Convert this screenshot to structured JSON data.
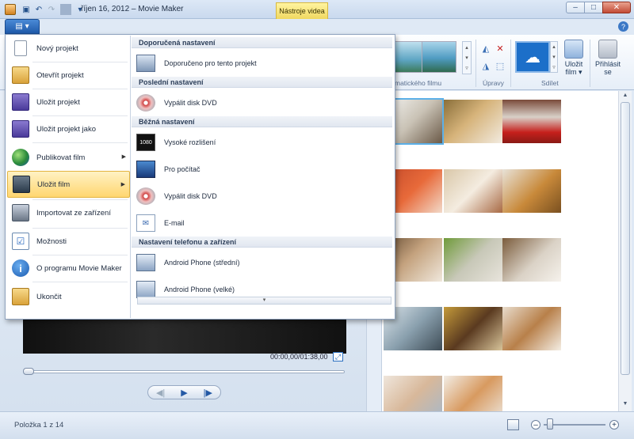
{
  "window": {
    "title": "říjen 16, 2012 – Movie Maker",
    "context_tab": "Nástroje videa",
    "controls": {
      "minimize": "–",
      "maximize": "□",
      "close": "✕"
    }
  },
  "quick_access": [
    "save-icon",
    "undo-icon",
    "redo-icon",
    "dropdown-icon"
  ],
  "ribbon": {
    "file_button_label": "▤ ▾",
    "help": "?",
    "groups": {
      "themes_label": "matického filmu",
      "edit_label": "Úpravy",
      "share_label": "Sdílet"
    },
    "save_movie": "Uložit film ▾",
    "sign_in": "Přihlásit se"
  },
  "file_menu": {
    "items": [
      {
        "label": "Nový projekt",
        "icon": "new-document-icon"
      },
      {
        "label": "Otevřít projekt",
        "icon": "open-folder-icon"
      },
      {
        "label": "Uložit projekt",
        "icon": "save-icon"
      },
      {
        "label": "Uložit projekt jako",
        "icon": "save-as-icon"
      },
      {
        "label": "Publikovat film",
        "icon": "publish-globe-icon",
        "submenu": true
      },
      {
        "label": "Uložit film",
        "icon": "film-strip-icon",
        "submenu": true,
        "active": true
      },
      {
        "label": "Importovat ze zařízení",
        "icon": "camera-import-icon"
      },
      {
        "label": "Možnosti",
        "icon": "options-checklist-icon"
      },
      {
        "label": "O programu Movie Maker",
        "icon": "info-icon"
      },
      {
        "label": "Ukončit",
        "icon": "exit-icon"
      }
    ]
  },
  "submenu": {
    "sections": [
      {
        "header": "Doporučená nastavení",
        "items": [
          {
            "label": "Doporučeno pro tento projekt",
            "icon": "recommended-settings-icon"
          }
        ]
      },
      {
        "header": "Poslední nastavení",
        "items": [
          {
            "label": "Vypálit disk DVD",
            "icon": "dvd-disc-icon"
          }
        ]
      },
      {
        "header": "Běžná nastavení",
        "items": [
          {
            "label": "Vysoké rozlišení",
            "icon": "hd-1080-icon"
          },
          {
            "label": "Pro počítač",
            "icon": "computer-icon"
          },
          {
            "label": "Vypálit disk DVD",
            "icon": "dvd-disc-icon"
          },
          {
            "label": "E-mail",
            "icon": "email-icon"
          }
        ]
      },
      {
        "header": "Nastavení telefonu a zařízení",
        "items": [
          {
            "label": "Android Phone (střední)",
            "icon": "phone-device-icon"
          },
          {
            "label": "Android Phone (velké)",
            "icon": "phone-device-icon"
          }
        ]
      }
    ],
    "scroll_glyph": "▾"
  },
  "preview": {
    "timecode": "00:00,00/01:38,00",
    "prev_frame": "◀|",
    "play": "▶",
    "next_frame": "|▶"
  },
  "status": {
    "text": "Položka 1 z 14",
    "zoom_out": "–",
    "zoom_in": "+"
  },
  "colors": {
    "accent": "#1f5aaa",
    "menu_highlight": "#ffd670",
    "context_tab": "#f0d860"
  }
}
